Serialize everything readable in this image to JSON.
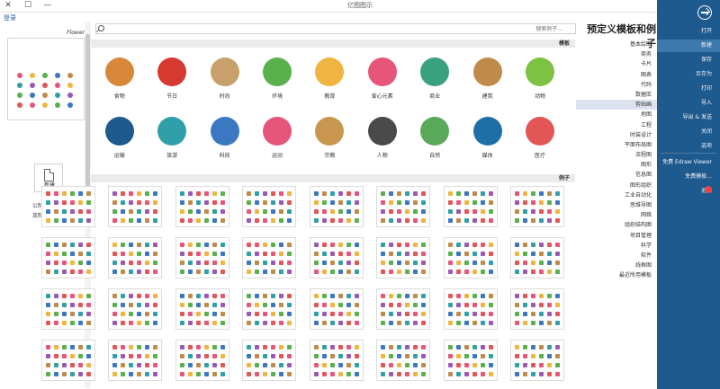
{
  "window": {
    "title": "亿图图示",
    "controls": {
      "close": "✕",
      "maximize": "☐",
      "minimize": "—"
    }
  },
  "left_panel": {
    "login_link": "登录",
    "preview_title": "Flower",
    "new_label": "新建",
    "options": [
      "公制单位",
      "英制单位"
    ]
  },
  "search": {
    "placeholder": "搜索例子..."
  },
  "page_title": "预定义模板和例子",
  "sections": {
    "templates": "模板",
    "examples": "例子"
  },
  "categories_row1": [
    {
      "label": "动物",
      "icon": "frog-icon",
      "color": "#7dc242"
    },
    {
      "label": "建筑",
      "icon": "castle-icon",
      "color": "#c08a4a"
    },
    {
      "label": "商业",
      "icon": "dollar-sign-icon",
      "color": "#3aa17e"
    },
    {
      "label": "爱心元素",
      "icon": "heart-icon",
      "color": "#e8557a"
    },
    {
      "label": "教育",
      "icon": "palette-icon",
      "color": "#f0b440"
    },
    {
      "label": "环境",
      "icon": "globe-icon",
      "color": "#5ab04c"
    },
    {
      "label": "时尚",
      "icon": "fashion-icon",
      "color": "#c7a06b"
    },
    {
      "label": "节日",
      "icon": "santa-icon",
      "color": "#d6392f"
    },
    {
      "label": "食物",
      "icon": "hamburger-icon",
      "color": "#d9883a"
    }
  ],
  "categories_row2": [
    {
      "label": "医疗",
      "icon": "molecule-icon",
      "color": "#e35656"
    },
    {
      "label": "媒体",
      "icon": "microphone-icon",
      "color": "#1e6fa8"
    },
    {
      "label": "自然",
      "icon": "landscape-icon",
      "color": "#5aa95a"
    },
    {
      "label": "人物",
      "icon": "person-icon",
      "color": "#4a4a4a"
    },
    {
      "label": "宗教",
      "icon": "church-icon",
      "color": "#c8964e"
    },
    {
      "label": "运动",
      "icon": "treadmill-icon",
      "color": "#e6557a"
    },
    {
      "label": "科技",
      "icon": "robot-icon",
      "color": "#3a78c2"
    },
    {
      "label": "旅游",
      "icon": "ferris-wheel-icon",
      "color": "#2fa0a8"
    },
    {
      "label": "运输",
      "icon": "train-icon",
      "color": "#1f5a8e"
    }
  ],
  "thumbnail_palette": [
    "#e8557a",
    "#f0b440",
    "#5ab04c",
    "#3a78c2",
    "#c08a4a",
    "#2fa0a8",
    "#9b59b6",
    "#e35656"
  ],
  "category_list": [
    {
      "label": "基本绘图",
      "selected": false
    },
    {
      "label": "商务",
      "selected": false
    },
    {
      "label": "卡片",
      "selected": false
    },
    {
      "label": "图表",
      "selected": false
    },
    {
      "label": "代码",
      "selected": false
    },
    {
      "label": "数据库",
      "selected": false
    },
    {
      "label": "剪贴画",
      "selected": true
    },
    {
      "label": "地图",
      "selected": false
    },
    {
      "label": "工程",
      "selected": false
    },
    {
      "label": "时装设计",
      "selected": false
    },
    {
      "label": "平面布局图",
      "selected": false
    },
    {
      "label": "流程图",
      "selected": false
    },
    {
      "label": "图形",
      "selected": false
    },
    {
      "label": "信息图",
      "selected": false
    },
    {
      "label": "图形组织",
      "selected": false
    },
    {
      "label": "工业自动化",
      "selected": false
    },
    {
      "label": "思维导图",
      "selected": false
    },
    {
      "label": "网络",
      "selected": false
    },
    {
      "label": "组织结构图",
      "selected": false
    },
    {
      "label": "项目管理",
      "selected": false
    },
    {
      "label": "科学",
      "selected": false
    },
    {
      "label": "软件",
      "selected": false
    },
    {
      "label": "线框图",
      "selected": false
    },
    {
      "label": "最近所用模板",
      "selected": false
    }
  ],
  "nav": {
    "items": [
      {
        "label": "新建",
        "selected": true
      },
      {
        "label": "保存",
        "selected": false
      },
      {
        "label": "另存为",
        "selected": false
      },
      {
        "label": "打印",
        "selected": false
      },
      {
        "label": "导入",
        "selected": false
      },
      {
        "label": "导出 & 发送",
        "selected": false
      },
      {
        "label": "关闭",
        "selected": false
      },
      {
        "label": "选项",
        "selected": false
      },
      {
        "label": "免费 Edraw Viewer",
        "selected": false
      },
      {
        "label": "免费模板...",
        "selected": false
      },
      {
        "label": "退出",
        "selected": false
      }
    ],
    "accent": "#1f5a8e",
    "open_label": "打开"
  }
}
